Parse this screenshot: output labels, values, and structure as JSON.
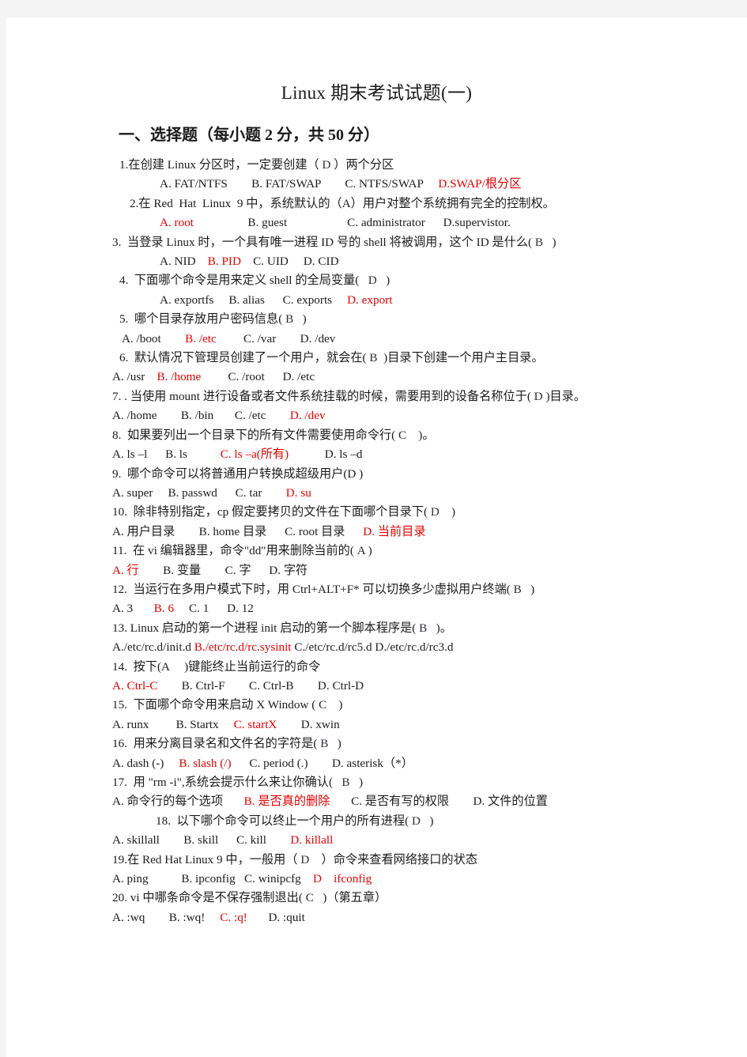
{
  "document": {
    "title": "Linux  期末考试试题(一)",
    "section_heading": "一、选择题（每小题 2 分，共 50 分）"
  },
  "questions": [
    {
      "number": "1.",
      "stem_before": "1.在创建 Linux 分区时，一定要创建（ ",
      "marker": "D",
      "stem_after": " ）两个分区",
      "options_plain": "A. FAT/NTFS        B. FAT/SWAP        C. NTFS/SWAP     ",
      "options_red": "D.SWAP/根分区",
      "options_tail": ""
    },
    {
      "number": "2.",
      "stem_before": "2.在 Red  Hat  Linux  9 中，系统默认的（A）用户对整个系统拥有完全的控制权。",
      "marker": "",
      "stem_after": "",
      "options_plain": "",
      "options_red": "A. root",
      "options_tail": "                  B. guest                    C. administrator      D.supervistor."
    },
    {
      "number": "3.",
      "stem_before": "3.  当登录 Linux 时，一个具有唯一进程 ID 号的 shell 将被调用，这个 ID 是什么( ",
      "marker": "B",
      "stem_after": "   )",
      "options_plain": "A. NID    ",
      "options_red": "B. PID",
      "options_tail": "    C. UID     D. CID"
    },
    {
      "number": "4.",
      "stem_before": "4.  下面哪个命令是用来定义 shell 的全局变量(   ",
      "marker": "D",
      "stem_after": "   )",
      "options_plain": "A. exportfs     B. alias      C. exports     ",
      "options_red": "D. export",
      "options_tail": ""
    },
    {
      "number": "5.",
      "stem_before": "5.  哪个目录存放用户密码信息( ",
      "marker": "B",
      "stem_after": "   )",
      "options_plain": " A. /boot        ",
      "options_red": "B. /etc",
      "options_tail": "         C. /var        D. /dev"
    },
    {
      "number": "6.",
      "stem_before": "6.  默认情况下管理员创建了一个用户，就会在( ",
      "marker": "B",
      "stem_after": "  )目录下创建一个用户主目录。",
      "options_plain": "A. /usr    ",
      "options_red": "B. /home",
      "options_tail": "         C. /root      D. /etc"
    },
    {
      "number": "7.",
      "stem_before": "7. . 当使用 mount 进行设备或者文件系统挂载的时候，需要用到的设备名称位于( ",
      "marker": "D",
      "stem_after": " )目录。",
      "options_plain": "A. /home        B. /bin       C. /etc        ",
      "options_red": "D. /dev",
      "options_tail": ""
    },
    {
      "number": "8.",
      "stem_before": "8.  如果要列出一个目录下的所有文件需要使用命令行( ",
      "marker": "C",
      "stem_after": "    )。",
      "options_plain": "A. ls –l      B. ls           ",
      "options_red": "C. ls –a(所有)",
      "options_tail": "            D. ls –d"
    },
    {
      "number": "9.",
      "stem_before": "9.  哪个命令可以将普通用户转换成超级用户(D )",
      "marker": "",
      "stem_after": "",
      "options_plain": "A. super     B. passwd      C. tar        ",
      "options_red": "D. su",
      "options_tail": ""
    },
    {
      "number": "10.",
      "stem_before": "10.  除非特别指定，cp 假定要拷贝的文件在下面哪个目录下( ",
      "marker": "D",
      "stem_after": "    )",
      "options_plain": "A. 用户目录        B. home 目录      C. root 目录      ",
      "options_red": "D. 当前目录",
      "options_tail": ""
    },
    {
      "number": "11.",
      "stem_before": "11.  在 vi 编辑器里，命令\"dd\"用来删除当前的( ",
      "marker": "A",
      "stem_after": " )",
      "options_plain": "",
      "options_red": "A. 行",
      "options_tail": "        B. 变量        C. 字      D. 字符"
    },
    {
      "number": "12.",
      "stem_before": "12.  当运行在多用户模式下时，用 Ctrl+ALT+F* 可以切换多少虚拟用户终端( ",
      "marker": "B",
      "stem_after": "   )",
      "options_plain": "A. 3       ",
      "options_red": "B. 6",
      "options_tail": "     C. 1      D. 12"
    },
    {
      "number": "13.",
      "stem_before": "13. Linux 启动的第一个进程 init 启动的第一个脚本程序是( ",
      "marker": "B",
      "stem_after": "   )。",
      "options_plain": "A./etc/rc.d/init.d ",
      "options_red": "B./etc/rc.d/rc.sysinit",
      "options_tail": " C./etc/rc.d/rc5.d D./etc/rc.d/rc3.d"
    },
    {
      "number": "14.",
      "stem_before": "14.  按下(A     )键能终止当前运行的命令",
      "marker": "",
      "stem_after": "",
      "options_plain": "",
      "options_red": "A. Ctrl-C",
      "options_tail": "        B. Ctrl-F        C. Ctrl-B        D. Ctrl-D"
    },
    {
      "number": "15.",
      "stem_before": "15.  下面哪个命令用来启动 X Window ( ",
      "marker": "C",
      "stem_after": "    )",
      "options_plain": "A. runx         B. Startx     ",
      "options_red": "C. startX",
      "options_tail": "        D. xwin"
    },
    {
      "number": "16.",
      "stem_before": "16.  用来分离目录名和文件名的字符是( ",
      "marker": "B",
      "stem_after": "   )",
      "options_plain": "A. dash (-)     ",
      "options_red": "B. slash (/)",
      "options_tail": "      C. period (.)        D. asterisk（*）"
    },
    {
      "number": "17.",
      "stem_before": "17.  用 \"rm -i\",系统会提示什么来让你确认(   ",
      "marker": "B",
      "stem_after": "   )",
      "options_plain": "A. 命令行的每个选项       ",
      "options_red": "B. 是否真的删除",
      "options_tail": "       C. 是否有写的权限        D. 文件的位置"
    },
    {
      "number": "18.",
      "stem_before": "18.  以下哪个命令可以终止一个用户的所有进程( ",
      "marker": "D",
      "stem_after": "   )",
      "options_plain": "A. skillall        B. skill      C. kill        ",
      "options_red": "D. killall",
      "options_tail": ""
    },
    {
      "number": "19.",
      "stem_before": "19.在 Red Hat Linux 9 中，一般用（ ",
      "marker": "D",
      "stem_after": "    ）命令来查看网络接口的状态",
      "options_plain": "A. ping           B. ipconfig   C. winipcfg    ",
      "options_red": "D    ifconfig",
      "options_tail": ""
    },
    {
      "number": "20.",
      "stem_before": "20. vi 中哪条命令是不保存强制退出( ",
      "marker": "C",
      "stem_after": "   )（第五章）",
      "options_plain": "A. :wq        B. :wq!     ",
      "options_red": "C. :q!",
      "options_tail": "       D. :quit"
    }
  ]
}
